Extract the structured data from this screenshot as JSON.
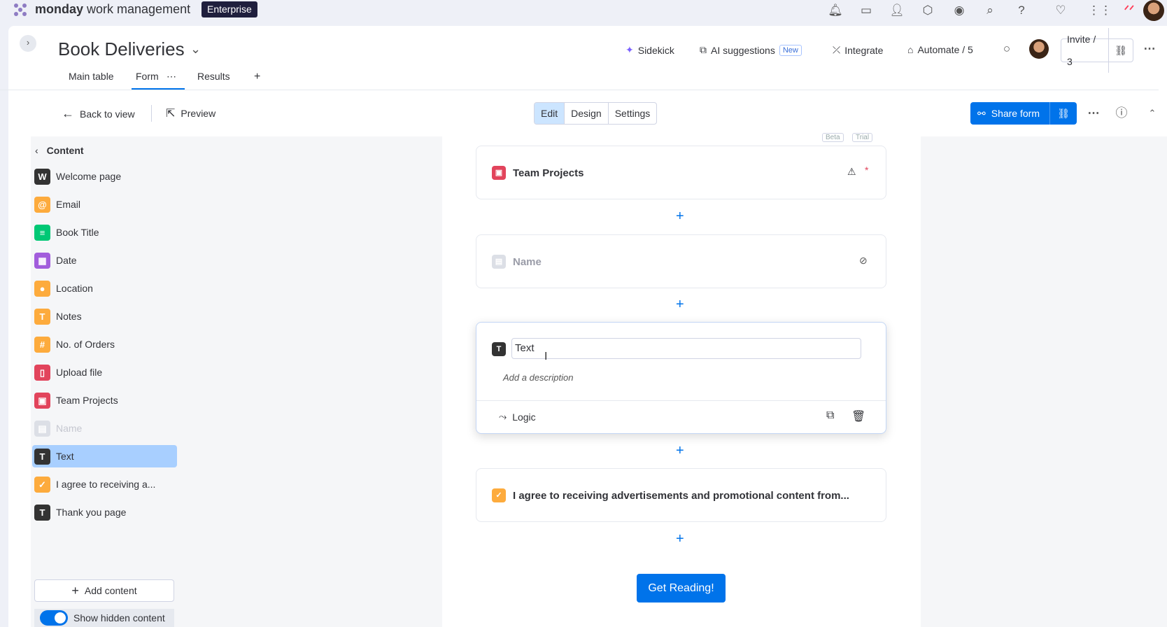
{
  "topbar": {
    "brand_bold": "monday",
    "brand_rest": " work management",
    "plan_badge": "Enterprise",
    "icons": [
      "bell-icon",
      "inbox-icon",
      "invite-members-icon",
      "apps-icon",
      "ai-icon",
      "search-icon",
      "help-icon",
      "heart-icon",
      "grid-icon",
      "monday-logo-icon",
      "avatar"
    ]
  },
  "header": {
    "title": "Book Deliveries",
    "sidekick": "Sidekick",
    "ai_suggestions": "AI suggestions",
    "new_badge": "New",
    "integrate": "Integrate",
    "automate": "Automate / 5",
    "invite": "Invite / 3"
  },
  "tabs": [
    {
      "label": "Main table"
    },
    {
      "label": "Form",
      "active": true
    },
    {
      "label": "Results"
    }
  ],
  "toolbar": {
    "back": "Back to view",
    "preview": "Preview",
    "modes": [
      "Edit",
      "Design",
      "Settings"
    ],
    "active_mode": "Edit",
    "share": "Share form"
  },
  "sidebar": {
    "heading": "Content",
    "items": [
      {
        "label": "Welcome page",
        "icon": "W",
        "color": "#333333"
      },
      {
        "label": "Email",
        "icon": "@",
        "color": "#fdab3d"
      },
      {
        "label": "Book Title",
        "icon": "≡",
        "color": "#00c875"
      },
      {
        "label": "Date",
        "icon": "▦",
        "color": "#a25ddc"
      },
      {
        "label": "Location",
        "icon": "●",
        "color": "#fdab3d"
      },
      {
        "label": "Notes",
        "icon": "T",
        "color": "#fdab3d"
      },
      {
        "label": "No. of Orders",
        "icon": "#",
        "color": "#fdab3d"
      },
      {
        "label": "Upload file",
        "icon": "▯",
        "color": "#e2445c"
      },
      {
        "label": "Team Projects",
        "icon": "▣",
        "color": "#e2445c"
      },
      {
        "label": "Name",
        "icon": "▤",
        "color": "#c5c7d0",
        "hidden": true
      },
      {
        "label": "Text",
        "icon": "T",
        "color": "#333333",
        "selected": true
      },
      {
        "label": "I agree to receiving a...",
        "icon": "✓",
        "color": "#fdab3d"
      },
      {
        "label": "Thank you page",
        "icon": "T",
        "color": "#333333"
      }
    ],
    "add_content": "Add content",
    "show_hidden": "Show hidden content"
  },
  "form": {
    "top_badges": [
      "Beta",
      "Trial"
    ],
    "q1": "Team Projects",
    "q2": "Name",
    "q3_value": "Text",
    "q3_description_placeholder": "Add a description",
    "q3_logic": "Logic",
    "q4": "I agree to receiving advertisements and promotional content from...",
    "submit": "Get Reading!"
  }
}
